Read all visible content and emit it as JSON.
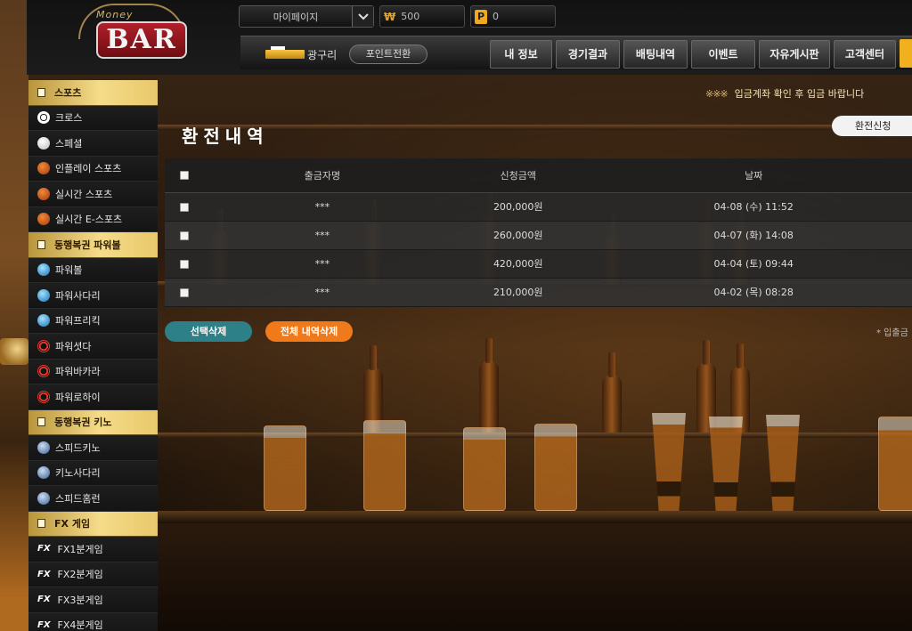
{
  "logo": {
    "sign": "BAR",
    "script": "Money"
  },
  "topbar": {
    "mypage_label": "마이페이지",
    "money_symbol": "₩",
    "money_value": "500",
    "point_symbol": "P",
    "point_value": "0"
  },
  "user": {
    "name": "광구리",
    "point_convert_label": "포인트전환"
  },
  "menu": [
    "내 정보",
    "경기결과",
    "배팅내역",
    "이벤트",
    "자유게시판",
    "고객센터"
  ],
  "notice": {
    "marks": "※※※",
    "text": "입금계좌 확인 후 입금 바랍니다"
  },
  "page": {
    "title": "환전내역",
    "request_button": "환전신청"
  },
  "table": {
    "headers": [
      "출금자명",
      "신청금액",
      "날짜"
    ],
    "rows": [
      {
        "name": "***",
        "amount": "200,000원",
        "date": "04-08 (수) 11:52"
      },
      {
        "name": "***",
        "amount": "260,000원",
        "date": "04-07 (화) 14:08"
      },
      {
        "name": "***",
        "amount": "420,000원",
        "date": "04-04 (토) 09:44"
      },
      {
        "name": "***",
        "amount": "210,000원",
        "date": "04-02 (목) 08:28"
      }
    ]
  },
  "actions": {
    "delete_selected": "선택삭제",
    "delete_all": "전체 내역삭제",
    "footnote": "* 입출금"
  },
  "sidebar": {
    "sports": "스포츠",
    "sports_items": [
      "크로스",
      "스페셜",
      "인플레이 스포츠",
      "실시간 스포츠",
      "실시간 E-스포츠"
    ],
    "powerball": "동행복권 파워볼",
    "powerball_items": [
      "파워볼",
      "파워사다리",
      "파워프리킥",
      "파워셧다",
      "파워바카라",
      "파워로하이"
    ],
    "keno": "동행복권 키노",
    "keno_items": [
      "스피드키노",
      "키노사다리",
      "스피드홈런"
    ],
    "fx": "FX 게임",
    "fx_items": [
      "FX1분게임",
      "FX2분게임",
      "FX3분게임",
      "FX4분게임"
    ],
    "fx_icon_text": "FX"
  },
  "colors": {
    "accent_gold": "#f5dc8a",
    "btn_teal": "#2d7f88",
    "btn_orange": "#f07a1a",
    "point_yellow": "#f0a81e"
  }
}
